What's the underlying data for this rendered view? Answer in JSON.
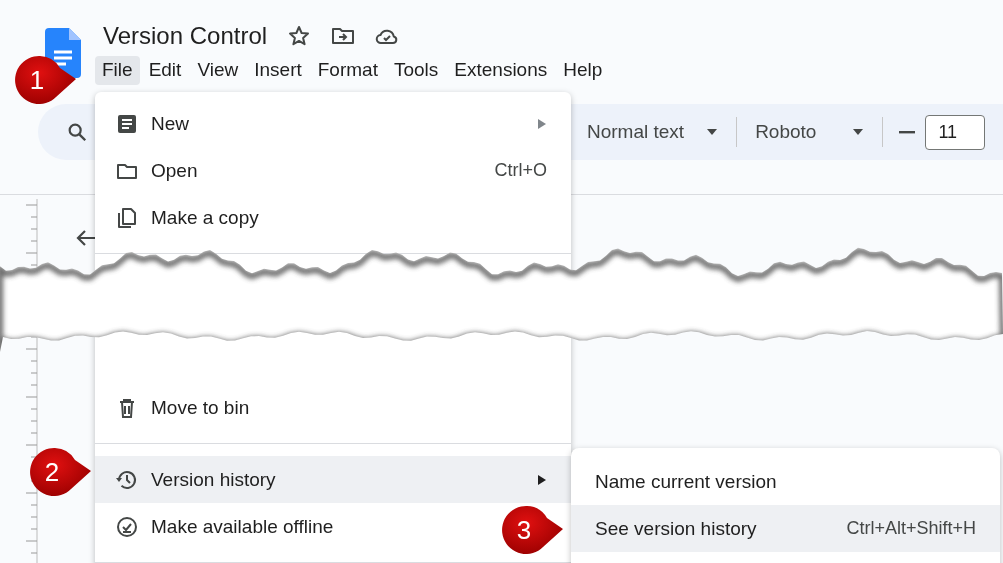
{
  "header": {
    "title": "Version Control"
  },
  "menu_bar": [
    {
      "label": "File",
      "selected": true
    },
    {
      "label": "Edit",
      "selected": false
    },
    {
      "label": "View",
      "selected": false
    },
    {
      "label": "Insert",
      "selected": false
    },
    {
      "label": "Format",
      "selected": false
    },
    {
      "label": "Tools",
      "selected": false
    },
    {
      "label": "Extensions",
      "selected": false
    },
    {
      "label": "Help",
      "selected": false
    }
  ],
  "toolbar": {
    "paragraph_style": "Normal text",
    "font": "Roboto",
    "font_size": "11"
  },
  "file_menu": {
    "sections": [
      [
        {
          "label": "New",
          "has_submenu": true,
          "selected": false
        },
        {
          "label": "Open",
          "shortcut": "Ctrl+O",
          "has_submenu": false,
          "selected": false
        },
        {
          "label": "Make a copy",
          "has_submenu": false,
          "selected": false
        }
      ],
      [
        {
          "label": "Move to bin",
          "has_submenu": false,
          "selected": false
        }
      ],
      [
        {
          "label": "Version history",
          "has_submenu": true,
          "selected": true
        },
        {
          "label": "Make available offline",
          "has_submenu": false,
          "selected": false
        }
      ]
    ]
  },
  "submenu": {
    "items": [
      {
        "label": "Name current version",
        "selected": false
      },
      {
        "label": "See version history",
        "shortcut": "Ctrl+Alt+Shift+H",
        "selected": true
      }
    ]
  },
  "callouts": [
    {
      "number": "1"
    },
    {
      "number": "2"
    },
    {
      "number": "3"
    }
  ]
}
